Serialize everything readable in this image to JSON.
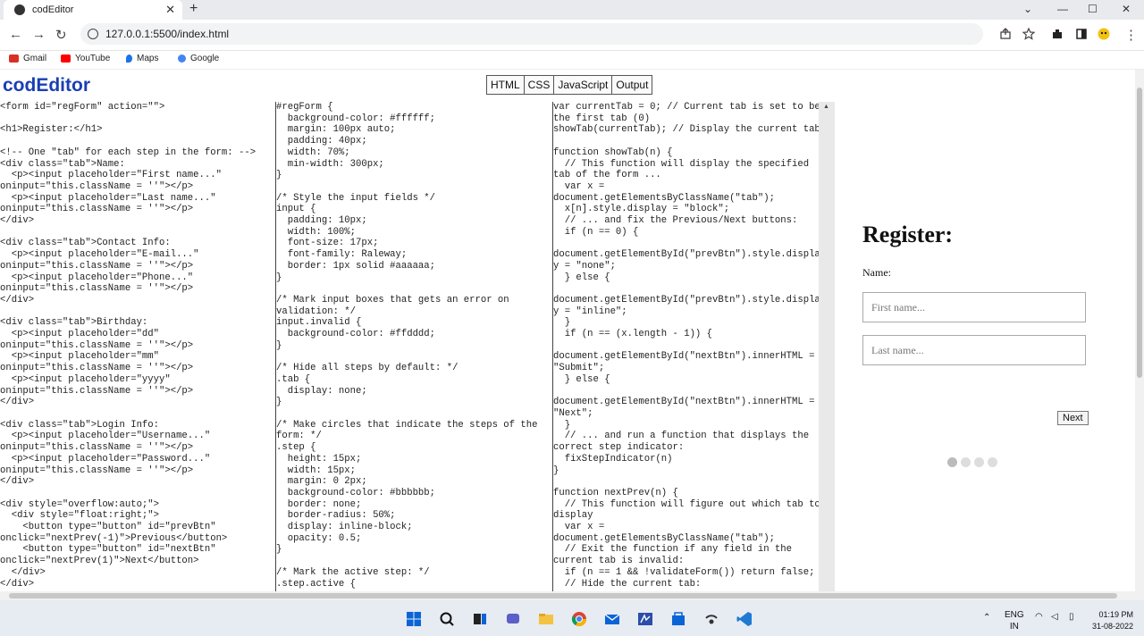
{
  "browser": {
    "tab_title": "codEditor",
    "tab_close": "✕",
    "new_tab": "+",
    "url": "127.0.0.1:5500/index.html",
    "bookmarks": [
      {
        "label": "Gmail",
        "color": "#d93025"
      },
      {
        "label": "YouTube",
        "color": "#ff0000"
      },
      {
        "label": "Maps",
        "color": "#1a73e8"
      },
      {
        "label": "Google",
        "color": "#4285f4"
      }
    ]
  },
  "app": {
    "logo": "codEditor",
    "tabs": [
      "HTML",
      "CSS",
      "JavaScript",
      "Output"
    ],
    "html_code": "<form id=\"regForm\" action=\"\">\n\n<h1>Register:</h1>\n\n<!-- One \"tab\" for each step in the form: -->\n<div class=\"tab\">Name:\n  <p><input placeholder=\"First name...\"\noninput=\"this.className = ''\"></p>\n  <p><input placeholder=\"Last name...\"\noninput=\"this.className = ''\"></p>\n</div>\n\n<div class=\"tab\">Contact Info:\n  <p><input placeholder=\"E-mail...\"\noninput=\"this.className = ''\"></p>\n  <p><input placeholder=\"Phone...\"\noninput=\"this.className = ''\"></p>\n</div>\n\n<div class=\"tab\">Birthday:\n  <p><input placeholder=\"dd\"\noninput=\"this.className = ''\"></p>\n  <p><input placeholder=\"mm\"\noninput=\"this.className = ''\"></p>\n  <p><input placeholder=\"yyyy\"\noninput=\"this.className = ''\"></p>\n</div>\n\n<div class=\"tab\">Login Info:\n  <p><input placeholder=\"Username...\"\noninput=\"this.className = ''\"></p>\n  <p><input placeholder=\"Password...\"\noninput=\"this.className = ''\"></p>\n</div>\n\n<div style=\"overflow:auto;\">\n  <div style=\"float:right;\">\n    <button type=\"button\" id=\"prevBtn\"\nonclick=\"nextPrev(-1)\">Previous</button>\n    <button type=\"button\" id=\"nextBtn\"\nonclick=\"nextPrev(1)\">Next</button>\n  </div>\n</div>",
    "css_code": "#regForm {\n  background-color: #ffffff;\n  margin: 100px auto;\n  padding: 40px;\n  width: 70%;\n  min-width: 300px;\n}\n\n/* Style the input fields */\ninput {\n  padding: 10px;\n  width: 100%;\n  font-size: 17px;\n  font-family: Raleway;\n  border: 1px solid #aaaaaa;\n}\n\n/* Mark input boxes that gets an error on\nvalidation: */\ninput.invalid {\n  background-color: #ffdddd;\n}\n\n/* Hide all steps by default: */\n.tab {\n  display: none;\n}\n\n/* Make circles that indicate the steps of the\nform: */\n.step {\n  height: 15px;\n  width: 15px;\n  margin: 0 2px;\n  background-color: #bbbbbb;\n  border: none;\n  border-radius: 50%;\n  display: inline-block;\n  opacity: 0.5;\n}\n\n/* Mark the active step: */\n.step.active {",
    "js_code": "var currentTab = 0; // Current tab is set to be\nthe first tab (0)\nshowTab(currentTab); // Display the current tab\n\nfunction showTab(n) {\n  // This function will display the specified\ntab of the form ...\n  var x =\ndocument.getElementsByClassName(\"tab\");\n  x[n].style.display = \"block\";\n  // ... and fix the Previous/Next buttons:\n  if (n == 0) {\n\ndocument.getElementById(\"prevBtn\").style.displa\ny = \"none\";\n  } else {\n\ndocument.getElementById(\"prevBtn\").style.displa\ny = \"inline\";\n  }\n  if (n == (x.length - 1)) {\n\ndocument.getElementById(\"nextBtn\").innerHTML =\n\"Submit\";\n  } else {\n\ndocument.getElementById(\"nextBtn\").innerHTML =\n\"Next\";\n  }\n  // ... and run a function that displays the\ncorrect step indicator:\n  fixStepIndicator(n)\n}\n\nfunction nextPrev(n) {\n  // This function will figure out which tab to\ndisplay\n  var x =\ndocument.getElementsByClassName(\"tab\");\n  // Exit the function if any field in the\ncurrent tab is invalid:\n  if (n == 1 && !validateForm()) return false;\n  // Hide the current tab:"
  },
  "output": {
    "title": "Register:",
    "section_label": "Name:",
    "first_placeholder": "First name...",
    "last_placeholder": "Last name...",
    "next_label": "Next",
    "steps_total": 4,
    "active_step": 1
  },
  "taskbar": {
    "lang_top": "ENG",
    "lang_bottom": "IN",
    "time": "01:19 PM",
    "date": "31-08-2022"
  }
}
